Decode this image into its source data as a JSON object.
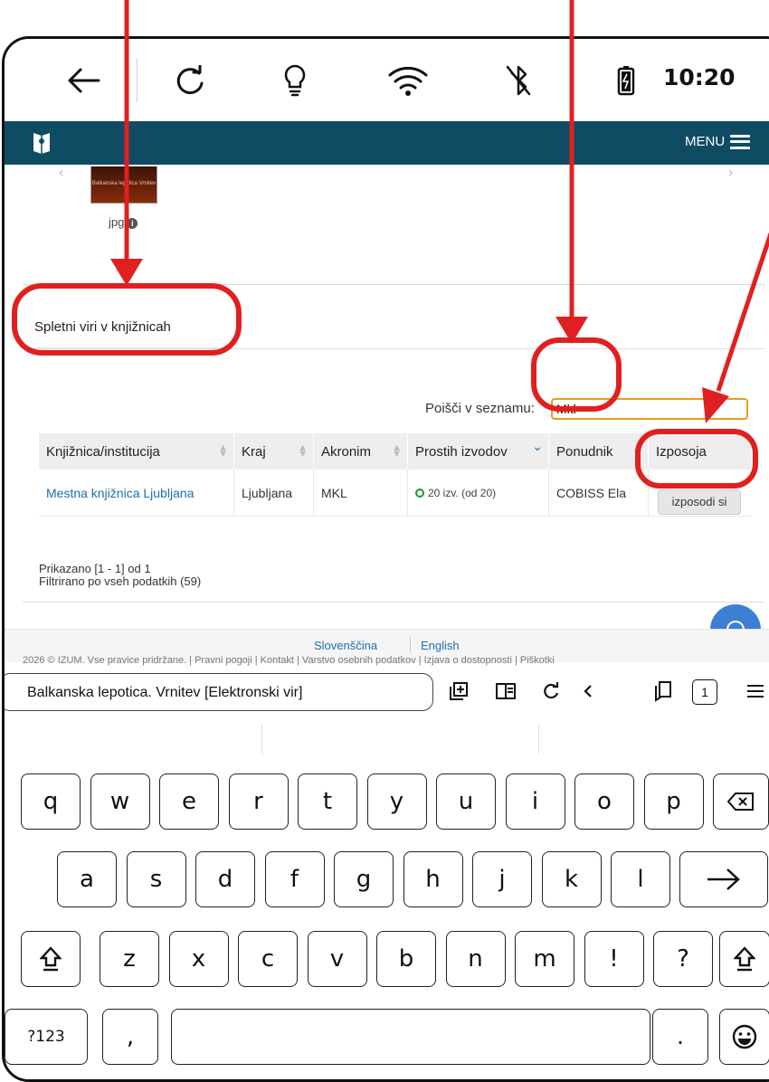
{
  "status_bar": {
    "time": "10:20",
    "icons": [
      "back-arrow-icon",
      "refresh-icon",
      "lightbulb-icon",
      "wifi-icon",
      "bluetooth-off-icon",
      "battery-icon"
    ]
  },
  "site_header": {
    "menu_label": "MENU"
  },
  "content": {
    "thumbnail_text": "Balkanska lepotica Vrnitev",
    "file_type": "jpg",
    "section_title": "Spletni viri v knjižnicah",
    "search": {
      "label": "Poišči v seznamu:",
      "value": "Mkl"
    },
    "table": {
      "columns": [
        "Knjižnica/institucija",
        "Kraj",
        "Akronim",
        "Prostih izvodov",
        "Ponudnik",
        "Izposoja"
      ],
      "rows": [
        {
          "library": "Mestna knjižnica Ljubljana",
          "city": "Ljubljana",
          "acronym": "MKL",
          "available": "20 izv. (od 20)",
          "provider": "COBISS Ela",
          "action": "izposodi si"
        }
      ]
    },
    "showing": "Prikazano [1 - 1] od 1",
    "filtered": "Filtrirano po vseh podatkih (59)"
  },
  "footer": {
    "languages": [
      "Slovenščina",
      "English"
    ],
    "copyright": "2026 © IZUM. Vse pravice pridržane. | Pravni pogoji | Kontakt | Varstvo osebnih podatkov | Izjava o dostopnosti | Piškotki"
  },
  "browser": {
    "url_text": "Balkanska lepotica. Vrnitev [Elektronski vir]",
    "tab_count": "1"
  },
  "keyboard": {
    "row1": [
      "q",
      "w",
      "e",
      "r",
      "t",
      "y",
      "u",
      "i",
      "o",
      "p"
    ],
    "row2": [
      "a",
      "s",
      "d",
      "f",
      "g",
      "h",
      "j",
      "k",
      "l"
    ],
    "row3": [
      "z",
      "x",
      "c",
      "v",
      "b",
      "n",
      "m",
      "!",
      "?"
    ],
    "row4": [
      "?123",
      ",",
      "."
    ]
  },
  "annotation_color": "#e02020"
}
